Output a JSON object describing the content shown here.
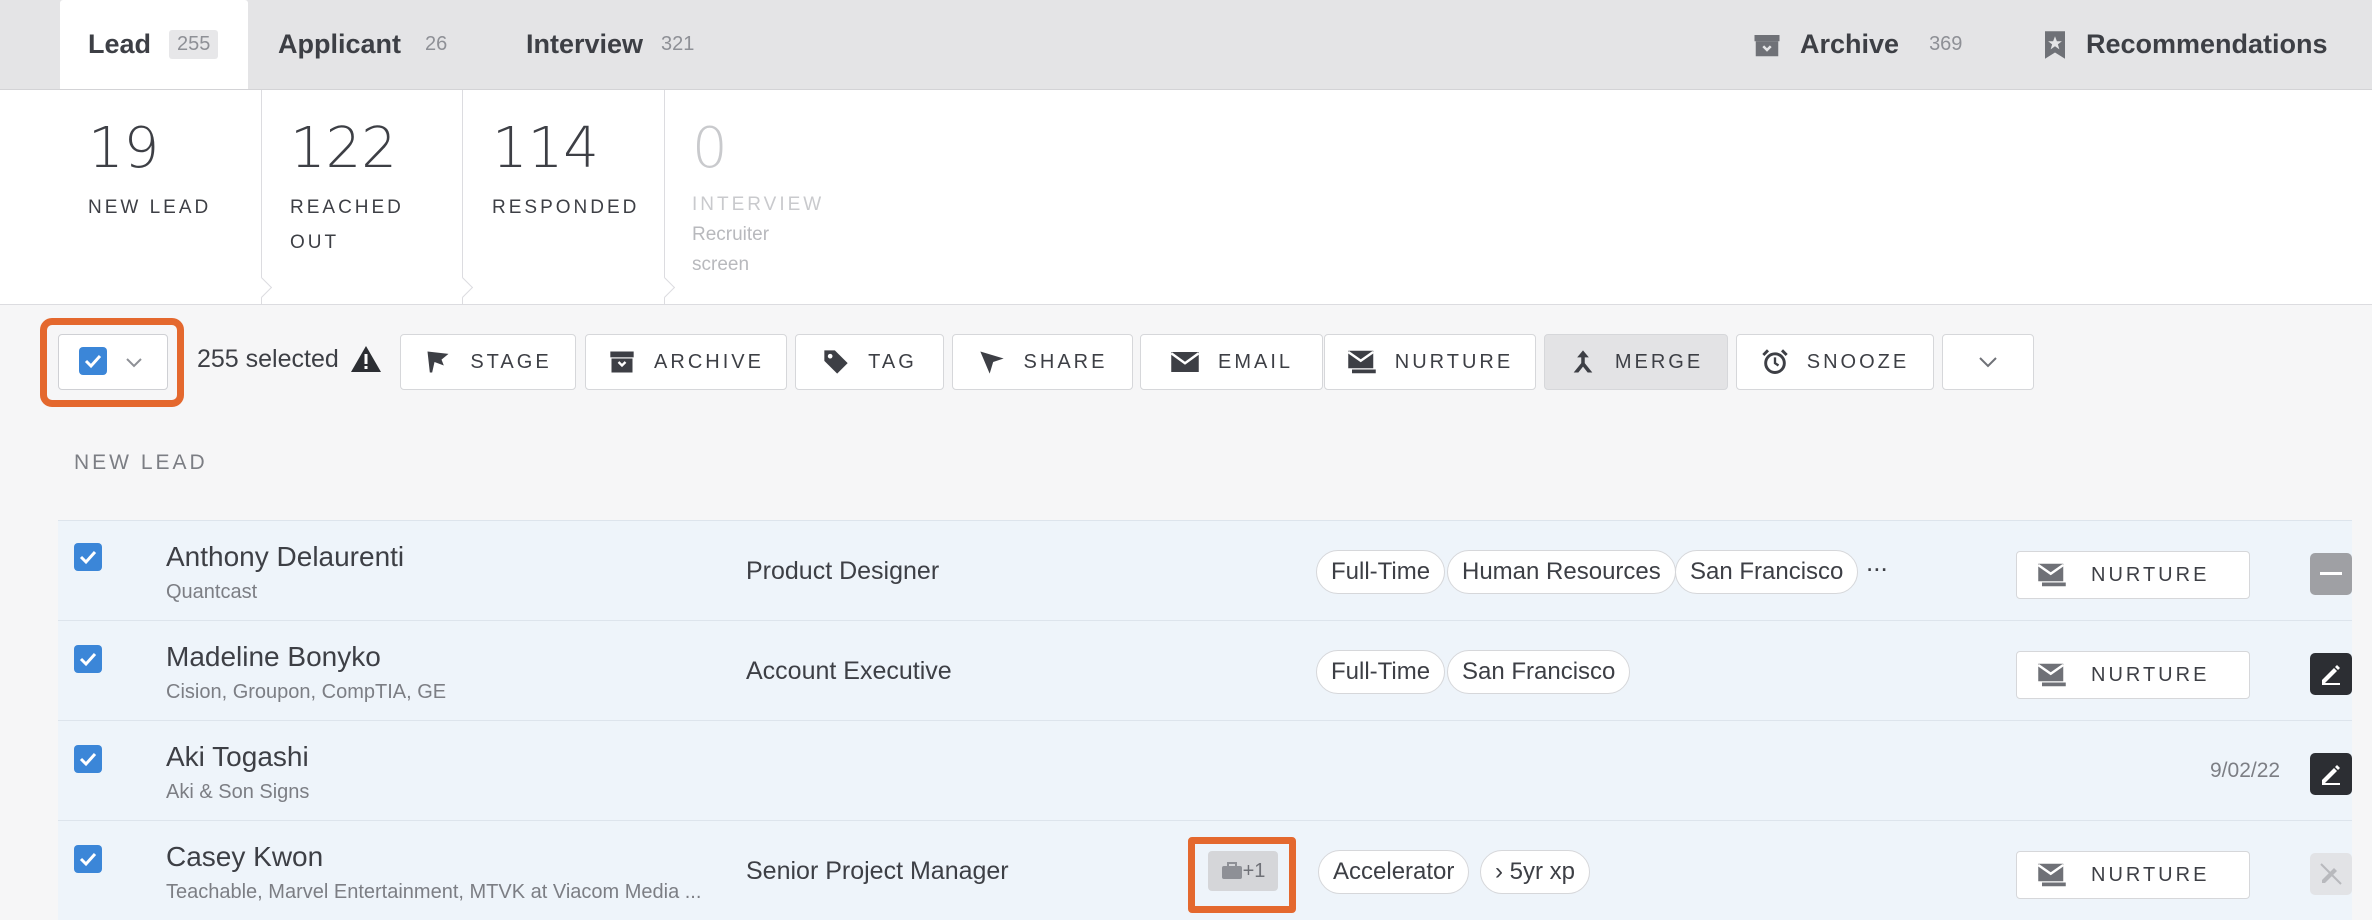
{
  "tabs": [
    {
      "label": "Lead",
      "count": "255"
    },
    {
      "label": "Applicant",
      "count": "26"
    },
    {
      "label": "Interview",
      "count": "321"
    }
  ],
  "header_links": {
    "archive": {
      "label": "Archive",
      "count": "369",
      "icon": "archive-box-icon"
    },
    "recommendations": {
      "label": "Recommendations",
      "icon": "star-bookmark-icon"
    }
  },
  "stages": [
    {
      "count": "19",
      "label": "NEW LEAD",
      "sub": ""
    },
    {
      "count": "122",
      "label": "REACHED OUT",
      "sub": ""
    },
    {
      "count": "114",
      "label": "RESPONDED",
      "sub": ""
    },
    {
      "count": "0",
      "label": "INTERVIEW",
      "sub": "Recruiter screen"
    }
  ],
  "toolbar": {
    "selected_text": "255 selected",
    "warning_icon": "warning-triangle-icon",
    "actions": [
      {
        "label": "STAGE",
        "icon": "flag-icon"
      },
      {
        "label": "ARCHIVE",
        "icon": "archive-box-icon"
      },
      {
        "label": "TAG",
        "icon": "tag-icon"
      },
      {
        "label": "SHARE",
        "icon": "share-cursor-icon"
      },
      {
        "label": "EMAIL",
        "icon": "envelope-icon"
      },
      {
        "label": "NURTURE",
        "icon": "nurture-envelope-icon"
      },
      {
        "label": "MERGE",
        "icon": "merge-arrows-icon"
      },
      {
        "label": "SNOOZE",
        "icon": "alarm-clock-icon"
      }
    ]
  },
  "section_title": "NEW LEAD",
  "rows": [
    {
      "name": "Anthony Delaurenti",
      "company": "Quantcast",
      "title": "Product Designer",
      "tags": [
        "Full-Time",
        "Human Resources",
        "San Francisco"
      ],
      "more": "...",
      "action": "NURTURE",
      "date": ""
    },
    {
      "name": "Madeline Bonyko",
      "company": "Cision, Groupon, CompTIA, GE",
      "title": "Account Executive",
      "tags": [
        "Full-Time",
        "San Francisco"
      ],
      "more": "",
      "action": "NURTURE",
      "date": ""
    },
    {
      "name": "Aki Togashi",
      "company": "Aki & Son Signs",
      "title": "",
      "tags": [],
      "more": "",
      "action": "",
      "date": "9/02/22"
    },
    {
      "name": "Casey Kwon",
      "company": "Teachable, Marvel Entertainment, MTVK at Viacom Media ...",
      "title": "Senior Project Manager",
      "job_badge": "+1",
      "tags": [
        "Accelerator",
        "› 5yr xp"
      ],
      "more": "",
      "action": "NURTURE",
      "date": ""
    }
  ],
  "colors": {
    "accent_blue": "#3b86d8",
    "highlight_orange": "#e4682e"
  }
}
